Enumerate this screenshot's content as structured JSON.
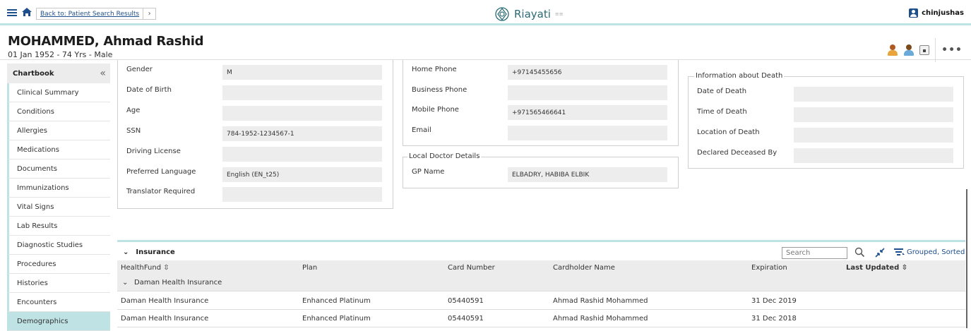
{
  "topbar": {
    "back_label": "Back to: Patient Search Results",
    "back_chevron": "›",
    "brand_name": "Riayati",
    "brand_sub": "≡≡",
    "username": "chinjushas"
  },
  "patient": {
    "name": "MOHAMMED, Ahmad Rashid",
    "info": "01 Jan 1952 - 74 Yrs - Male",
    "more": "•••"
  },
  "sidebar": {
    "title": "Chartbook",
    "collapse": "«",
    "items": [
      {
        "label": "Clinical Summary"
      },
      {
        "label": "Conditions"
      },
      {
        "label": "Allergies"
      },
      {
        "label": "Medications"
      },
      {
        "label": "Documents"
      },
      {
        "label": "Immunizations"
      },
      {
        "label": "Vital Signs"
      },
      {
        "label": "Lab Results"
      },
      {
        "label": "Diagnostic Studies"
      },
      {
        "label": "Procedures"
      },
      {
        "label": "Histories"
      },
      {
        "label": "Encounters"
      },
      {
        "label": "Demographics"
      }
    ]
  },
  "personal": {
    "rows": [
      {
        "label": "Gender",
        "value": "M"
      },
      {
        "label": "Date of Birth",
        "value": ""
      },
      {
        "label": "Age",
        "value": ""
      },
      {
        "label": "SSN",
        "value": "784-1952-1234567-1"
      },
      {
        "label": "Driving License",
        "value": ""
      },
      {
        "label": "Preferred Language",
        "value": "English (EN_t25)"
      },
      {
        "label": "Translator Required",
        "value": ""
      }
    ]
  },
  "contact": {
    "rows": [
      {
        "label": "Home Phone",
        "value": "+97145455656"
      },
      {
        "label": "Business Phone",
        "value": ""
      },
      {
        "label": "Mobile Phone",
        "value": "+971565466641"
      },
      {
        "label": "Email",
        "value": ""
      }
    ]
  },
  "local_doctor": {
    "legend": "Local Doctor Details",
    "label": "GP Name",
    "value": "ELBADRY, HABIBA ELBIK"
  },
  "death": {
    "legend": "Information about Death",
    "rows": [
      {
        "label": "Date of Death",
        "value": ""
      },
      {
        "label": "Time of Death",
        "value": ""
      },
      {
        "label": "Location of Death",
        "value": ""
      },
      {
        "label": "Declared Deceased By",
        "value": ""
      }
    ]
  },
  "insurance": {
    "title": "Insurance",
    "toggle": "⌄",
    "search_placeholder": "Search",
    "grouped_label": "Grouped, Sorted",
    "columns": [
      "HealthFund ⇳",
      "Plan",
      "Card Number",
      "Cardholder Name",
      "Expiration",
      "Last Updated ⇳"
    ],
    "group": "Daman Health Insurance",
    "rows": [
      {
        "fund": "Daman Health Insurance",
        "plan": "Enhanced Platinum",
        "card": "05440591",
        "holder": "Ahmad Rashid Mohammed",
        "exp": "31 Dec 2019",
        "updated": ""
      },
      {
        "fund": "Daman Health Insurance",
        "plan": "Enhanced Platinum",
        "card": "05440591",
        "holder": "Ahmad Rashid Mohammed",
        "exp": "31 Dec 2018",
        "updated": ""
      }
    ]
  }
}
